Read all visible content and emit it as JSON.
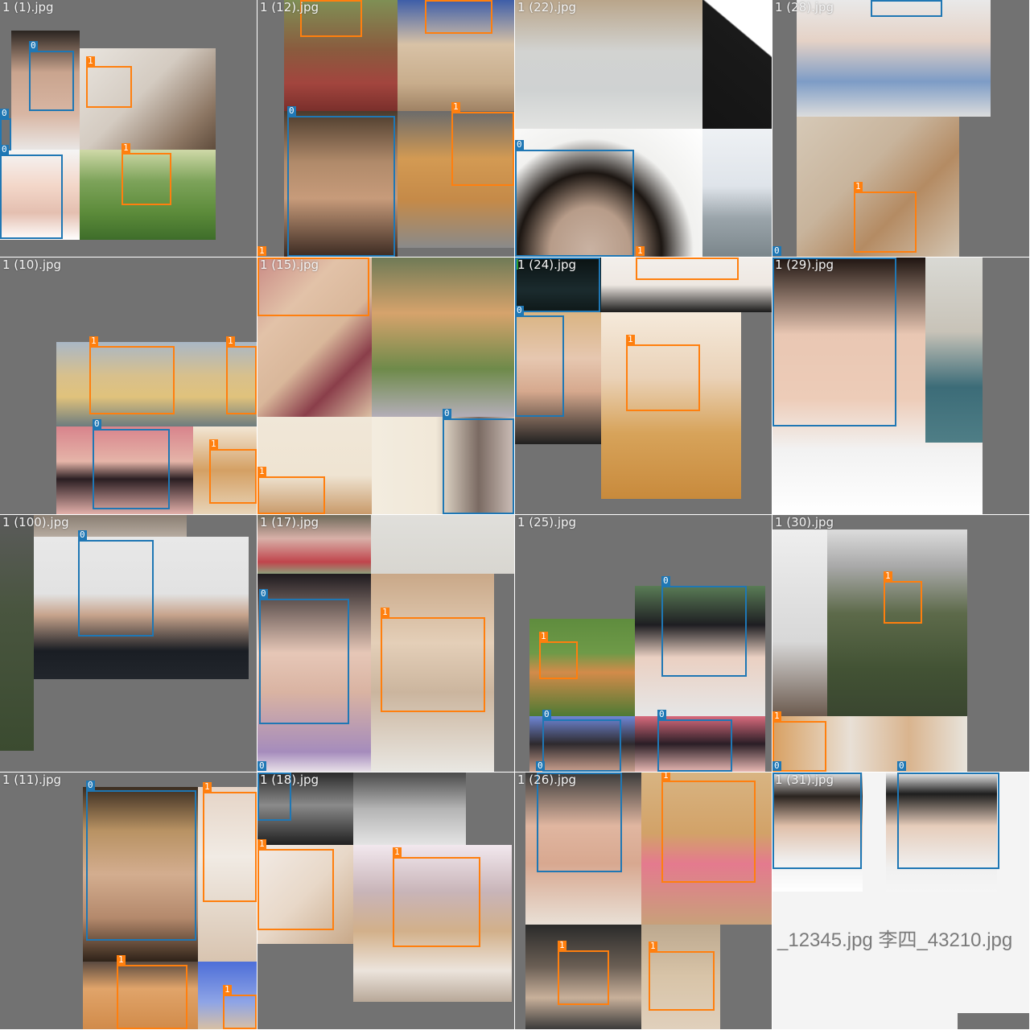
{
  "grid": {
    "title": ""
  },
  "colors": {
    "class_0": "#1f77b4",
    "class_1": "#ff7f0e",
    "fill": "#727272"
  },
  "tiles": [
    {
      "label": "1 (1).jpg"
    },
    {
      "label": "1 (12).jpg"
    },
    {
      "label": "1 (22).jpg"
    },
    {
      "label": "1 (28).jpg"
    },
    {
      "label": "1 (10).jpg"
    },
    {
      "label": "1 (15).jpg"
    },
    {
      "label": "1 (24).jpg"
    },
    {
      "label": "1 (29).jpg"
    },
    {
      "label": "1 (100).jpg"
    },
    {
      "label": "1 (17).jpg"
    },
    {
      "label": "1 (25).jpg"
    },
    {
      "label": "1 (30).jpg"
    },
    {
      "label": "1 (11).jpg"
    },
    {
      "label": "1 (18).jpg"
    },
    {
      "label": "1 (26).jpg"
    },
    {
      "label": "1 (31).jpg",
      "overlay_text": "_12345.jpg 李四_43210.jpg"
    }
  ],
  "class_tags": {
    "face": "0",
    "dog": "1"
  }
}
